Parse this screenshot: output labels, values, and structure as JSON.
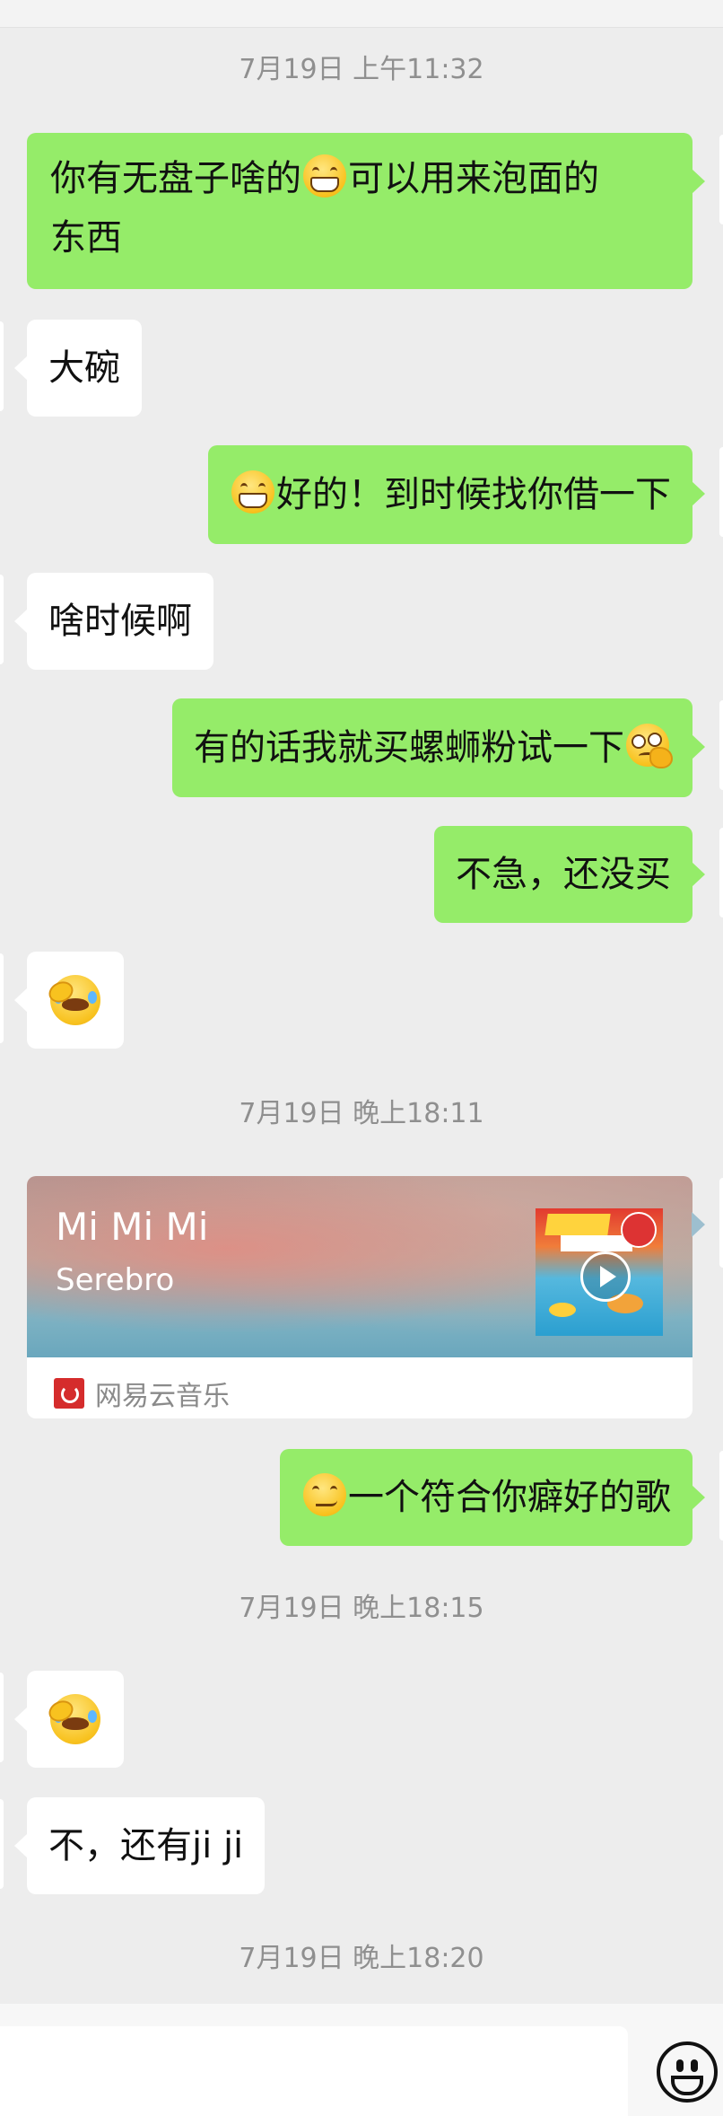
{
  "chat": {
    "timestamps": [
      "7月19日 上午11:32",
      "7月19日 晚上18:11",
      "7月19日 晚上18:15",
      "7月19日 晚上18:20"
    ],
    "messages": [
      {
        "side": "out",
        "line1": "你有无盘子啥的",
        "emoji": "grin-icon",
        "line1b": "可以用来泡面的",
        "line2": "东西"
      },
      {
        "side": "in",
        "text": "大碗"
      },
      {
        "side": "out",
        "emoji": "grin-icon",
        "text": "好的！到时候找你借一下"
      },
      {
        "side": "in",
        "text": "啥时候啊"
      },
      {
        "side": "out",
        "text": "有的话我就买螺蛳粉试一下",
        "emoji": "woozy-thinking-icon"
      },
      {
        "side": "out",
        "text": "不急，还没买"
      },
      {
        "side": "in",
        "emoji": "facepalm-cry-icon"
      },
      {
        "side": "out",
        "emoji": "smirk-icon",
        "text": "一个符合你癖好的歌"
      },
      {
        "side": "in",
        "emoji": "facepalm-cry-icon"
      },
      {
        "side": "in",
        "text": "不，还有ji ji"
      }
    ],
    "music_card": {
      "title": "Mi Mi Mi",
      "artist": "Serebro",
      "source": "网易云音乐",
      "cover_icon": "album-cover-icon",
      "play_icon": "play-icon",
      "source_icon": "netease-music-icon"
    }
  },
  "input": {
    "emoji_button_icon": "emoji-face-icon"
  },
  "colors": {
    "outgoing_bubble": "#95ec69",
    "incoming_bubble": "#ffffff",
    "background": "#ededed",
    "timestamp_text": "#8f8f8f"
  }
}
